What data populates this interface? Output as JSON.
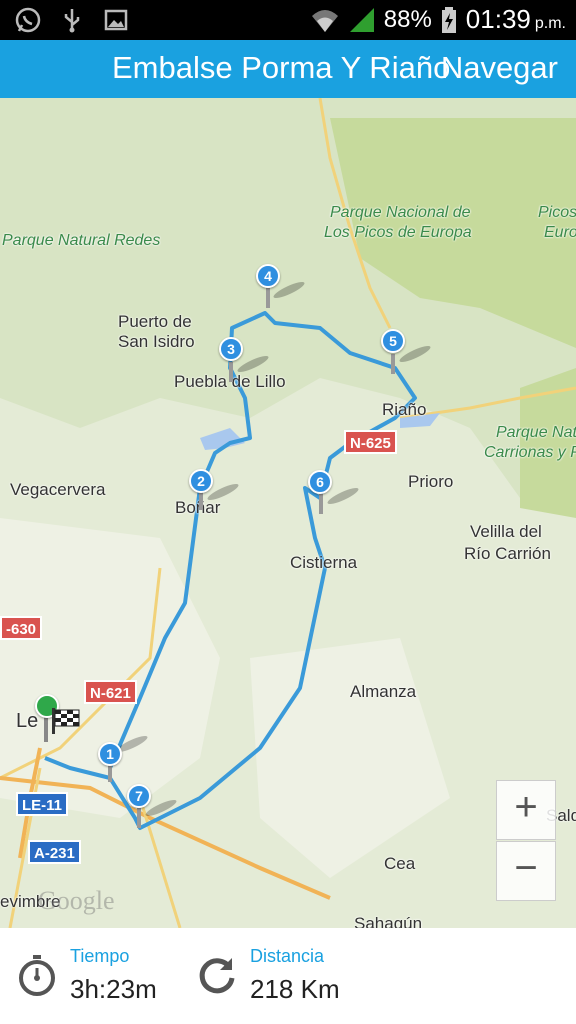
{
  "status_bar": {
    "left_icons": [
      "whatsapp-icon",
      "usb-icon",
      "image-icon"
    ],
    "battery": "88%",
    "time": "01:39",
    "ampm": "p.m."
  },
  "action_bar": {
    "title": "Embalse Porma Y Riaño",
    "nav_button": "Navegar"
  },
  "map": {
    "labels": {
      "parque_nacional": "Parque Nacional de",
      "picos_de_europa": "Los Picos de Europa",
      "picos_a": "Picos",
      "picos_b": "Euro",
      "parque_redes": "Parque Natural Redes",
      "puerto": "Puerto de",
      "san_isidro": "San Isidro",
      "puebla": "Puebla de Lillo",
      "riano": "Riaño",
      "parque_nat": "Parque Nat",
      "carrionas": "Carrionas y P",
      "vegacervera": "Vegacervera",
      "bonar": "Boñar",
      "prioro": "Prioro",
      "velilla_a": "Velilla del",
      "velilla_b": "Río Carrión",
      "cistierna": "Cistierna",
      "almanza": "Almanza",
      "leon": "Le",
      "cea": "Cea",
      "sahagun": "Sahagún",
      "sald": "Sald",
      "vimbre": "evimbre",
      "google": "Google"
    },
    "roads": {
      "n625": "N-625",
      "n621": "N-621",
      "n630": "-630",
      "le11": "LE-11",
      "a231": "A-231"
    },
    "markers": [
      "1",
      "2",
      "3",
      "4",
      "5",
      "6",
      "7"
    ],
    "route_color": "#3a9ad9",
    "zoom_in": "+",
    "zoom_out": "−"
  },
  "summary": {
    "time_label": "Tiempo",
    "time_value": "3h:23m",
    "distance_label": "Distancia",
    "distance_value": "218 Km"
  }
}
